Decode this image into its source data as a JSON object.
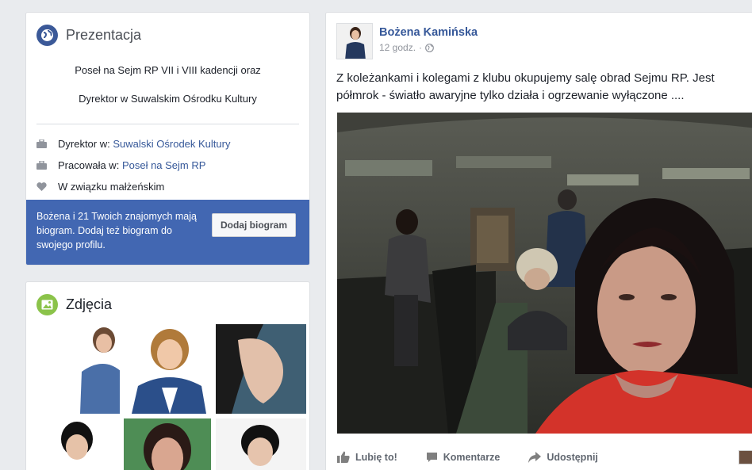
{
  "intro": {
    "title": "Prezentacja",
    "bio_line_1": "Poseł na Sejm RP VII i VIII kadencji oraz",
    "bio_line_2": "Dyrektor w Suwalskim Ośrodku Kultury",
    "rows": [
      {
        "icon": "briefcase-icon",
        "prefix": "Dyrektor w:",
        "link": "Suwalski Ośrodek Kultury"
      },
      {
        "icon": "briefcase-icon",
        "prefix": "Pracowała w:",
        "link": "Poseł na Sejm RP"
      },
      {
        "icon": "heart-icon",
        "prefix": "W związku małżeńskim",
        "link": ""
      }
    ],
    "promo_text": "Bożena i 21 Twoich znajomych mają biogram. Dodaj też biogram do swojego profilu.",
    "promo_button": "Dodaj biogram"
  },
  "photos": {
    "title": "Zdjęcia"
  },
  "post": {
    "author": "Bożena Kamińska",
    "time": "12 godz.",
    "separator": "·",
    "privacy_icon": "globe-icon",
    "text": "Z koleżankami i kolegami z klubu okupujemy salę obrad Sejmu RP. Jest półmrok - światło awaryjne tylko działa i ogrzewanie wyłączone ....",
    "actions": {
      "like": "Lubię to!",
      "comment": "Komentarze",
      "share": "Udostępnij"
    }
  },
  "colors": {
    "fb_blue": "#4267b2",
    "link_blue": "#365899",
    "background": "#e9ebee"
  }
}
